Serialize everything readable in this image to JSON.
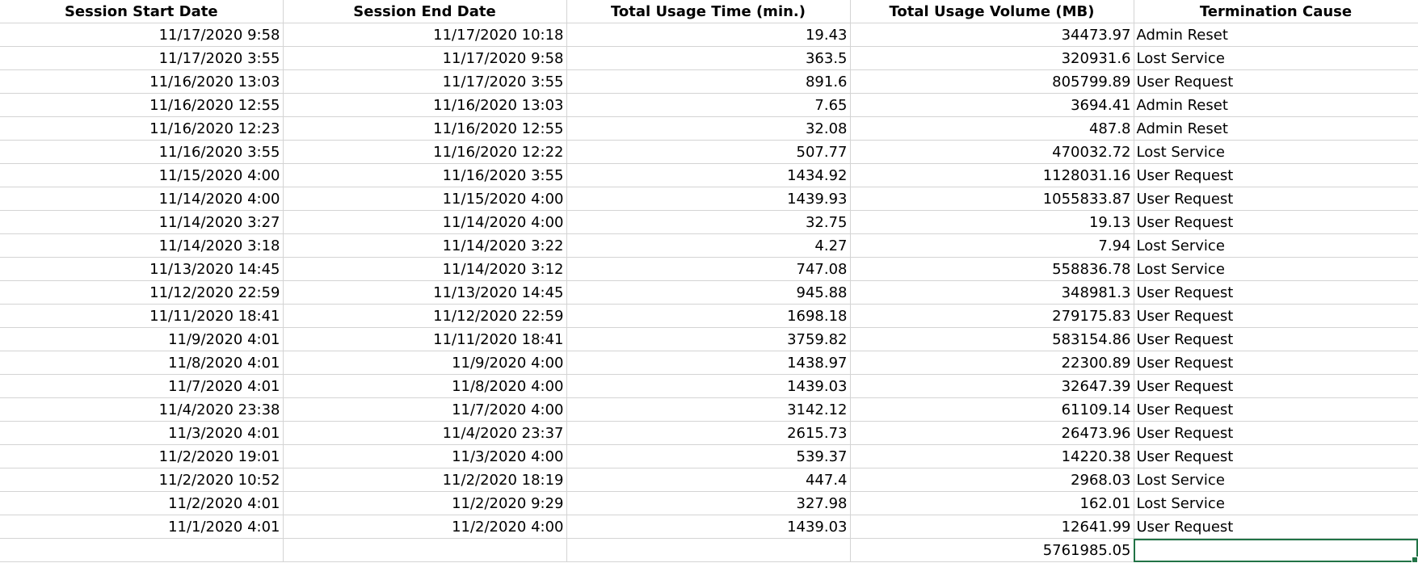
{
  "sheet": {
    "headers": [
      "Session Start Date",
      "Session End Date",
      "Total Usage Time (min.)",
      "Total Usage Volume (MB)",
      "Termination Cause"
    ],
    "rows": [
      [
        "11/17/2020 9:58",
        "11/17/2020 10:18",
        "19.43",
        "34473.97",
        "Admin Reset"
      ],
      [
        "11/17/2020 3:55",
        "11/17/2020 9:58",
        "363.5",
        "320931.6",
        "Lost Service"
      ],
      [
        "11/16/2020 13:03",
        "11/17/2020 3:55",
        "891.6",
        "805799.89",
        "User Request"
      ],
      [
        "11/16/2020 12:55",
        "11/16/2020 13:03",
        "7.65",
        "3694.41",
        "Admin Reset"
      ],
      [
        "11/16/2020 12:23",
        "11/16/2020 12:55",
        "32.08",
        "487.8",
        "Admin Reset"
      ],
      [
        "11/16/2020 3:55",
        "11/16/2020 12:22",
        "507.77",
        "470032.72",
        "Lost Service"
      ],
      [
        "11/15/2020 4:00",
        "11/16/2020 3:55",
        "1434.92",
        "1128031.16",
        "User Request"
      ],
      [
        "11/14/2020 4:00",
        "11/15/2020 4:00",
        "1439.93",
        "1055833.87",
        "User Request"
      ],
      [
        "11/14/2020 3:27",
        "11/14/2020 4:00",
        "32.75",
        "19.13",
        "User Request"
      ],
      [
        "11/14/2020 3:18",
        "11/14/2020 3:22",
        "4.27",
        "7.94",
        "Lost Service"
      ],
      [
        "11/13/2020 14:45",
        "11/14/2020 3:12",
        "747.08",
        "558836.78",
        "Lost Service"
      ],
      [
        "11/12/2020 22:59",
        "11/13/2020 14:45",
        "945.88",
        "348981.3",
        "User Request"
      ],
      [
        "11/11/2020 18:41",
        "11/12/2020 22:59",
        "1698.18",
        "279175.83",
        "User Request"
      ],
      [
        "11/9/2020 4:01",
        "11/11/2020 18:41",
        "3759.82",
        "583154.86",
        "User Request"
      ],
      [
        "11/8/2020 4:01",
        "11/9/2020 4:00",
        "1438.97",
        "22300.89",
        "User Request"
      ],
      [
        "11/7/2020 4:01",
        "11/8/2020 4:00",
        "1439.03",
        "32647.39",
        "User Request"
      ],
      [
        "11/4/2020 23:38",
        "11/7/2020 4:00",
        "3142.12",
        "61109.14",
        "User Request"
      ],
      [
        "11/3/2020 4:01",
        "11/4/2020 23:37",
        "2615.73",
        "26473.96",
        "User Request"
      ],
      [
        "11/2/2020 19:01",
        "11/3/2020 4:00",
        "539.37",
        "14220.38",
        "User Request"
      ],
      [
        "11/2/2020 10:52",
        "11/2/2020 18:19",
        "447.4",
        "2968.03",
        "Lost Service"
      ],
      [
        "11/2/2020 4:01",
        "11/2/2020 9:29",
        "327.98",
        "162.01",
        "Lost Service"
      ],
      [
        "11/1/2020 4:01",
        "11/2/2020 4:00",
        "1439.03",
        "12641.99",
        "User Request"
      ]
    ],
    "total_row": [
      "",
      "",
      "",
      "5761985.05",
      ""
    ],
    "selection_color": "#217346",
    "gridline_color": "#d4d4d4"
  }
}
